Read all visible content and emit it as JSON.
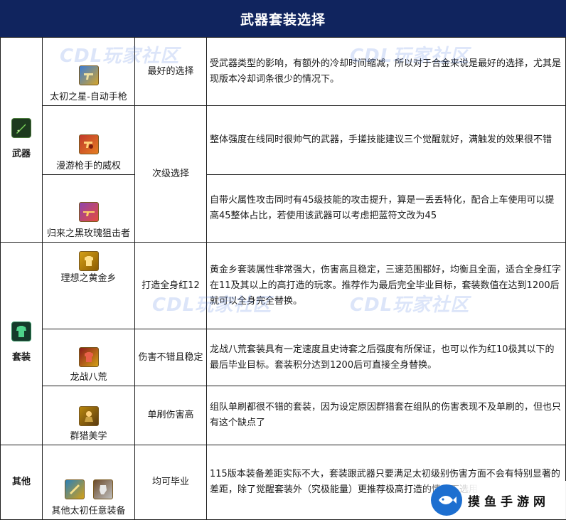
{
  "title": "武器套装选择",
  "watermark": "CDL玩家社区",
  "logo_text": "摸鱼手游网",
  "colors": {
    "header_bg": "#10245e",
    "header_text": "#ffffff",
    "border": "#1f1f1f"
  },
  "sections": [
    {
      "category": "武器",
      "icon": "sword-icon",
      "rows": [
        {
          "item": "太初之星-自动手枪",
          "icon": "pistol-icon",
          "note": "最好的选择",
          "desc": "受武器类型的影响，有额外的冷却时间缩减，所以对于合金来说是最好的选择，尤其是现版本冷却词条很少的情况下。"
        },
        {
          "item": "漫游枪手的威权",
          "icon": "revolver-icon",
          "note": "次级选择",
          "desc": "整体强度在线同时很帅气的武器，手搓技能建议三个觉醒就好，满触发的效果很不错"
        },
        {
          "item": "归来之黑玫瑰狙击者",
          "icon": "sniper-icon",
          "note": "",
          "desc": "自带火属性攻击同时有45级技能的攻击提升，算是一丢丢特化，配合上车使用可以提高45整体占比，若使用该武器可以考虑把蓝符文改为45"
        }
      ]
    },
    {
      "category": "套装",
      "icon": "armor-icon",
      "rows": [
        {
          "item": "理想之黄金乡",
          "icon": "gold-armor-icon",
          "note": "打造全身红12",
          "desc": "黄金乡套装属性非常强大，伤害高且稳定，三速范围都好，均衡且全面，适合全身红字在11及其以上的高打造的玩家。推荐作为最后完全毕业目标，套装数值在达到1200后就可以全身完全替换。"
        },
        {
          "item": "龙战八荒",
          "icon": "dragon-armor-icon",
          "note": "伤害不错且稳定",
          "desc": "龙战八荒套装具有一定速度且史诗套之后强度有所保证，也可以作为红10极其以下的最后毕业目标。套装积分达到1200后可直接全身替换。"
        },
        {
          "item": "群猎美学",
          "icon": "hunter-armor-icon",
          "note": "单刷伤害高",
          "desc": "组队单刷都很不错的套装，因为设定原因群猎套在组队的伤害表现不及单刷的，但也只有这个缺点了"
        }
      ]
    },
    {
      "category": "其他",
      "rows": [
        {
          "item": "其他太初任意装备",
          "icon": "primal-gear-icon",
          "note": "均可毕业",
          "desc": "115版本装备差距实际不大，套装跟武器只要满足太初级别伤害方面不会有特别显著的差距，除了觉醒套装外（究极能量）更推荐极高打造的情况下选用"
        }
      ]
    }
  ]
}
